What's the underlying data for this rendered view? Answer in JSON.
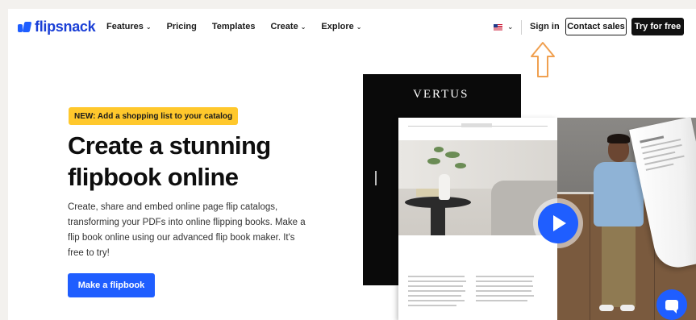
{
  "brand": {
    "logo_text": "flipsnack",
    "color": "#1f5eff"
  },
  "nav": {
    "items": [
      {
        "label": "Features",
        "dropdown": true
      },
      {
        "label": "Pricing",
        "dropdown": false
      },
      {
        "label": "Templates",
        "dropdown": false
      },
      {
        "label": "Create",
        "dropdown": true
      },
      {
        "label": "Explore",
        "dropdown": true
      }
    ],
    "language_icon": "us-flag-icon",
    "signin_label": "Sign in",
    "contact_label": "Contact sales",
    "try_label": "Try for free"
  },
  "hero": {
    "badge": "NEW: Add a shopping list to your catalog",
    "headline_line1": "Create a stunning",
    "headline_line2": "flipbook online",
    "description": "Create, share and embed online page flip catalogs, transforming your PDFs into online flipping books. Make a flip book online using our advanced flip book maker. It's free to try!",
    "cta_label": "Make a flipbook"
  },
  "visual": {
    "book_title": "VERTUS",
    "play_icon": "play-icon",
    "chat_icon": "chat-icon"
  },
  "annotation": {
    "arrow_color": "#f0a050",
    "arrow_icon": "arrow-up-icon"
  }
}
